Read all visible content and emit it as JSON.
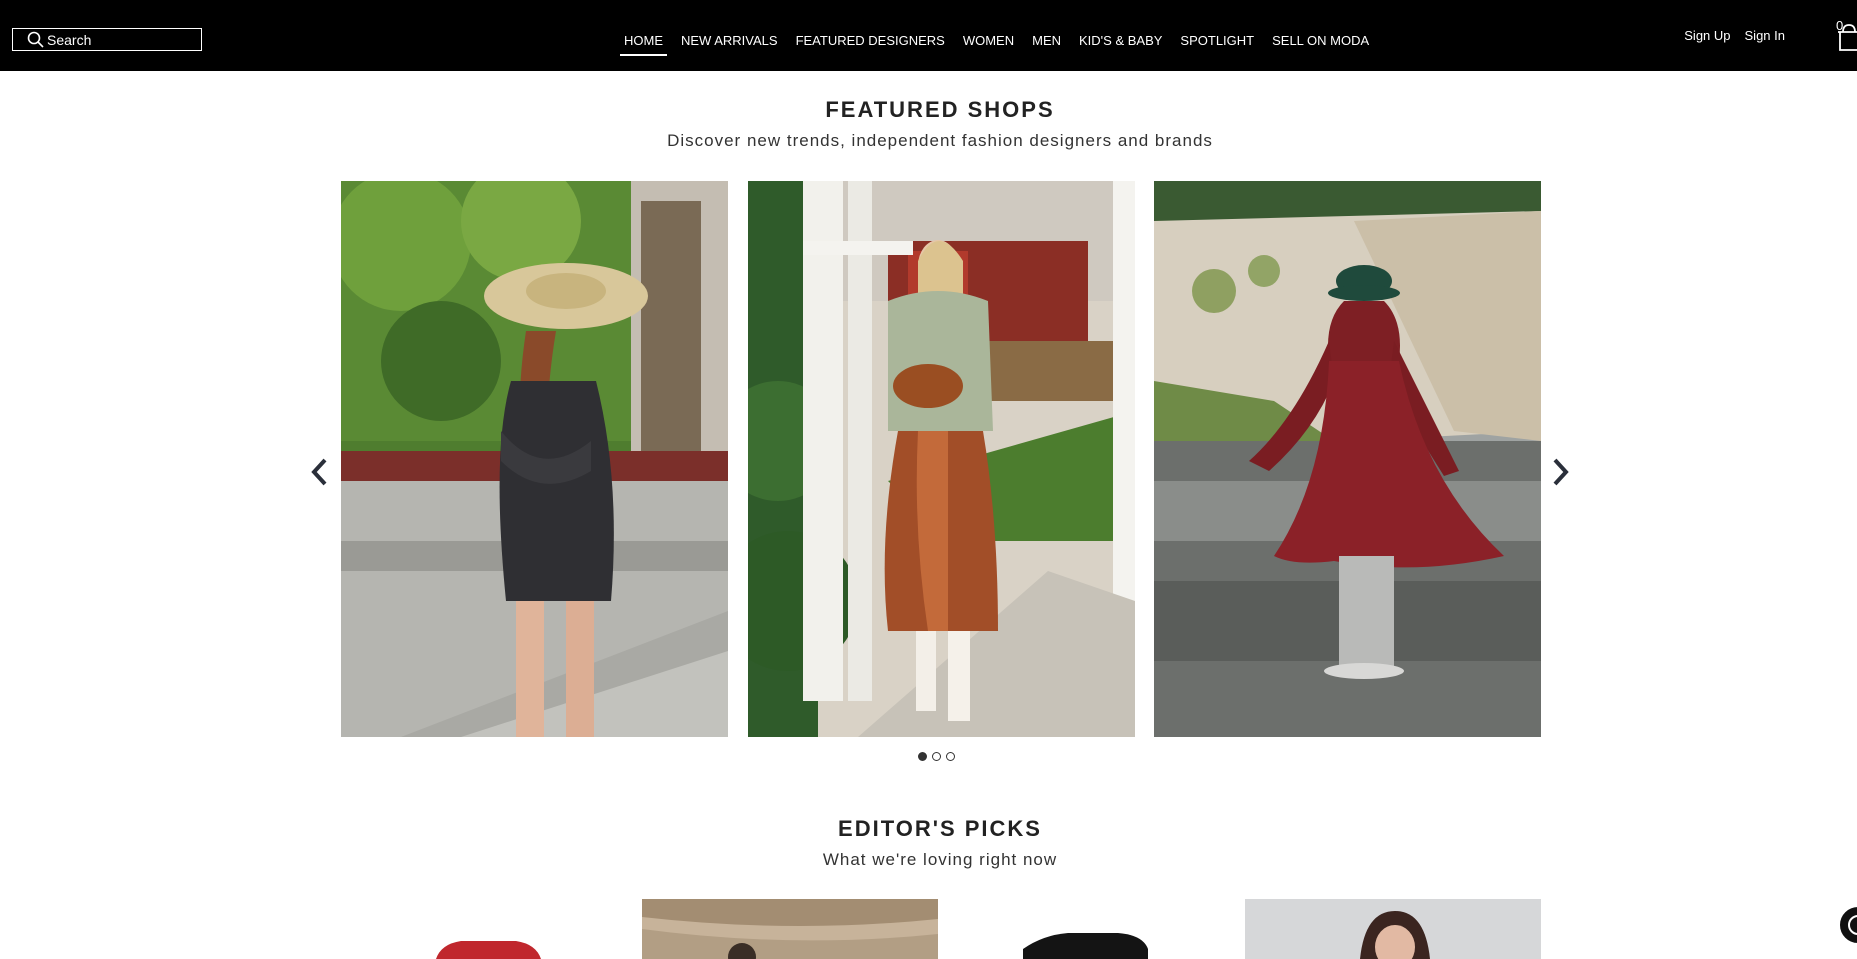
{
  "header": {
    "search_placeholder": "Search",
    "nav": [
      {
        "label": "HOME",
        "active": true
      },
      {
        "label": "NEW ARRIVALS"
      },
      {
        "label": "FEATURED DESIGNERS"
      },
      {
        "label": "WOMEN"
      },
      {
        "label": "MEN"
      },
      {
        "label": "KID'S & BABY"
      },
      {
        "label": "SPOTLIGHT"
      },
      {
        "label": "SELL ON MODA"
      }
    ],
    "sign_up": "Sign Up",
    "sign_in": "Sign In",
    "cart_count": "0"
  },
  "featured": {
    "title": "FEATURED SHOPS",
    "subtitle": "Discover new trends, independent fashion designers and brands",
    "slides": [
      "slide-hat-black-dress",
      "slide-satin-skirt",
      "slide-red-coat"
    ],
    "active_dot": 1,
    "dot_count": 3
  },
  "editors": {
    "title": "EDITOR'S PICKS",
    "subtitle": "What we're loving right now"
  },
  "colors": {
    "header_bg": "#000000",
    "text": "#222222"
  }
}
